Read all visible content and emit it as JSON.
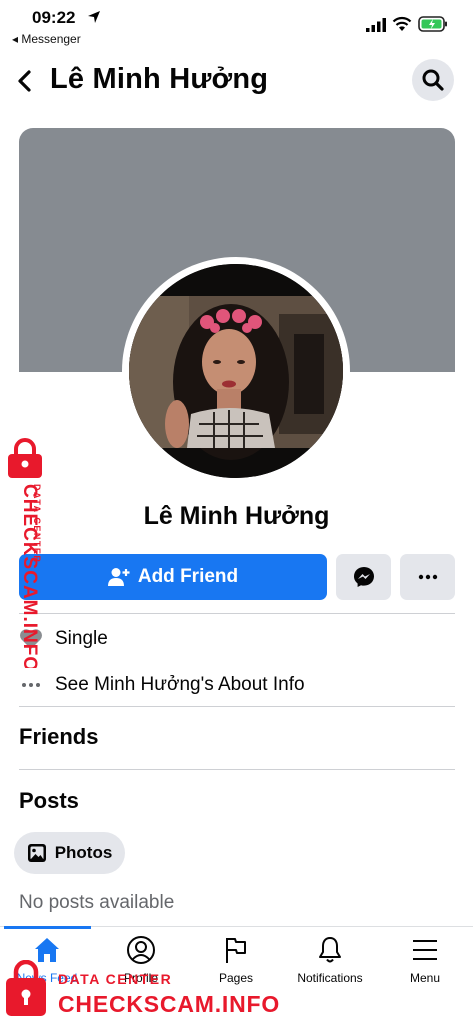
{
  "status_bar": {
    "time": "09:22",
    "back_app": "◂ Messenger"
  },
  "header": {
    "title": "Lê Minh Hưởng"
  },
  "profile": {
    "name": "Lê Minh Hưởng"
  },
  "actions": {
    "add_friend_label": "Add Friend"
  },
  "intro": {
    "relationship": "Single",
    "about_link": "See Minh Hưởng's About Info"
  },
  "sections": {
    "friends_title": "Friends",
    "posts_title": "Posts",
    "photos_label": "Photos",
    "no_posts": "No posts available"
  },
  "bottom_nav": {
    "items": [
      {
        "label": "News Feed",
        "icon": "home-icon",
        "active": true
      },
      {
        "label": "Profile",
        "icon": "profile-icon",
        "active": false
      },
      {
        "label": "Pages",
        "icon": "flag-icon",
        "active": false
      },
      {
        "label": "Notifications",
        "icon": "bell-icon",
        "active": false
      },
      {
        "label": "Menu",
        "icon": "menu-icon",
        "active": false
      }
    ]
  },
  "watermark": {
    "brand": "CHECKSCAM.INFO",
    "tagline": "DATA CENTER"
  },
  "colors": {
    "accent": "#1877f2",
    "cover": "#868b91",
    "button_gray": "#e4e6eb",
    "watermark_red": "#e8192c"
  }
}
